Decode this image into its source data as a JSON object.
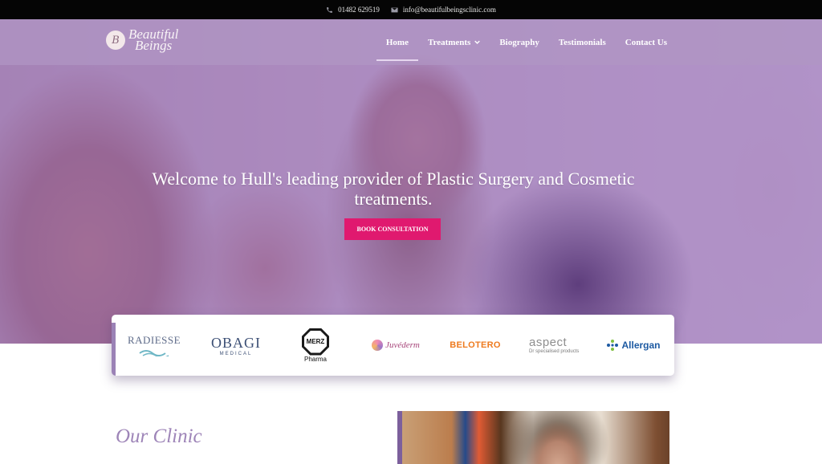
{
  "topbar": {
    "phone": "01482 629519",
    "email": "info@beautifulbeingsclinic.com"
  },
  "logo": {
    "mark": "B",
    "line1": "Beautiful",
    "line2": "Beings"
  },
  "nav": {
    "items": [
      {
        "label": "Home",
        "active": true
      },
      {
        "label": "Treatments",
        "has_dropdown": true
      },
      {
        "label": "Biography"
      },
      {
        "label": "Testimonials"
      },
      {
        "label": "Contact Us"
      }
    ]
  },
  "hero": {
    "headline": "Welcome to Hull's leading provider of Plastic Surgery and Cosmetic treatments.",
    "cta_label": "BOOK CONSULTATION"
  },
  "brands": {
    "radiesse": "RADIESSE",
    "obagi": "OBAGI",
    "obagi_sub": "MEDICAL",
    "merz": "MERZ",
    "merz_sub": "Pharma",
    "juvederm": "Juvéderm",
    "belotero": "BELOTERO",
    "aspect": "aspect",
    "aspect_sub": "Dr specialised products",
    "allergan": "Allergan"
  },
  "section": {
    "title": "Our Clinic"
  },
  "colors": {
    "topbar": "#050505",
    "hero_tint": "#804eaa",
    "cta": "#e0196f",
    "heading_accent": "#9e85b8"
  },
  "icons": {
    "phone": "phone-icon",
    "email": "envelope-icon",
    "dropdown": "chevron-down-icon"
  }
}
